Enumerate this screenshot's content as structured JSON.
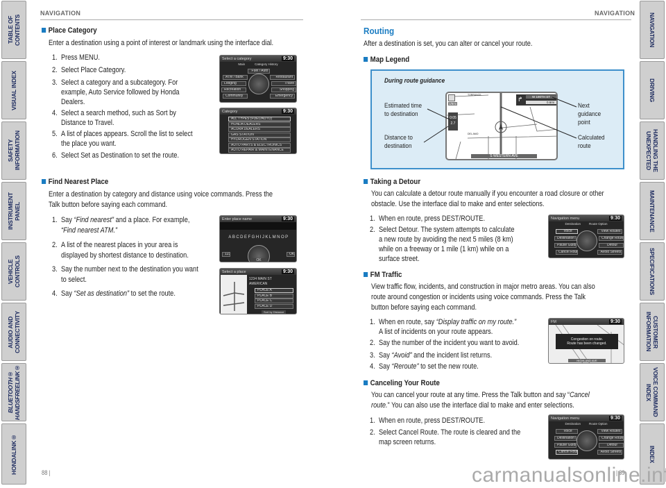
{
  "left_tabs": [
    "TABLE OF CONTENTS",
    "VISUAL INDEX",
    "SAFETY\nINFORMATION",
    "INSTRUMENT PANEL",
    "VEHICLE\nCONTROLS",
    "AUDIO AND\nCONNECTIVITY",
    "BLUETOOTH®\nHANDSFREELINK®",
    "HONDALINK®"
  ],
  "right_tabs": [
    "NAVIGATION",
    "DRIVING",
    "HANDLING THE\nUNEXPECTED",
    "MAINTENANCE",
    "SPECIFICATIONS",
    "CUSTOMER\nINFORMATION",
    "VOICE COMMAND\nINDEX",
    "INDEX"
  ],
  "left_page": {
    "header": "NAVIGATION",
    "page_number": "88 |",
    "place_category": {
      "heading": "Place Category",
      "intro": "Enter a destination using a point of interest or landmark using the interface dial.",
      "steps": [
        {
          "num": "1.",
          "lines": [
            "Press MENU."
          ]
        },
        {
          "num": "2.",
          "lines": [
            "Select Place Category."
          ]
        },
        {
          "num": "3.",
          "lines": [
            "Select a category and a subcategory. For",
            "example, Auto Service followed by Honda",
            "Dealers."
          ]
        },
        {
          "num": "4.",
          "lines": [
            "Select a search method, such as Sort by",
            "Distance to Travel."
          ]
        },
        {
          "num": "5.",
          "lines": [
            "A list of places appears. Scroll the list to select",
            "the place you want."
          ]
        },
        {
          "num": "6.",
          "lines": [
            "Select Set as Destination to set the route."
          ]
        }
      ]
    },
    "find_nearest": {
      "heading": "Find Nearest Place",
      "intro": [
        "Enter a destination by category and distance using voice commands. Press the",
        "Talk button before saying each command."
      ],
      "step1": {
        "num": "1.",
        "pre": "Say ",
        "em": "“Find nearest”",
        "post": " and a place. For example,",
        "em2": "“Find nearest ATM.”"
      },
      "step2": {
        "num": "2.",
        "lines": [
          "A list of the nearest places in your area is",
          "displayed by shortest distance to destination."
        ]
      },
      "step3": {
        "num": "3.",
        "lines": [
          "Say the number next to the destination you want",
          "to select."
        ]
      },
      "step4": {
        "num": "4.",
        "pre": "Say ",
        "em": "“Set as destination”",
        "post": " to set the route."
      }
    }
  },
  "right_page": {
    "header": "NAVIGATION",
    "page_number": "| 89",
    "routing": {
      "title": "Routing",
      "intro": "After a destination is set, you can alter or cancel your route."
    },
    "map_legend": {
      "heading": "Map Legend",
      "caption": "During route guidance",
      "labels": {
        "eta": [
          "Estimated time",
          "to destination"
        ],
        "distance": [
          "Distance to",
          "destination"
        ],
        "next": [
          "Next",
          "guidance",
          "point"
        ],
        "route": [
          "Calculated",
          "route"
        ]
      },
      "map_text": {
        "street": "W 190TH ST",
        "dist": "0.6mi",
        "bottom": "S WESTERN AVE",
        "road1": "DEL AMO",
        "road2": "TORRANCE",
        "scale": "1/8mi",
        "eta": "0:05",
        "remaining": "2.7"
      }
    },
    "detour": {
      "heading": "Taking a Detour",
      "intro": [
        "You can calculate a detour route manually if you encounter a road closure or other",
        "obstacle. Use the interface dial to make and enter selections."
      ],
      "steps": [
        {
          "num": "1.",
          "lines": [
            "When en route, press DEST/ROUTE."
          ]
        },
        {
          "num": "2.",
          "lines": [
            "Select Detour. The system attempts to calculate",
            "a new route by avoiding the next 5 miles (8 km)",
            "while on a freeway or 1 mile (1 km) while on a",
            "surface street."
          ]
        }
      ]
    },
    "fm_traffic": {
      "heading": "FM Traffic",
      "intro": [
        "View traffic flow, incidents, and construction in major metro areas. You can also",
        "route around congestion or incidents using voice commands. Press the Talk",
        "button before saying each command."
      ],
      "step1": {
        "num": "1.",
        "pre": "When en route, say ",
        "em": "“Display traffic on my route.”",
        "line2": "A list of incidents on your route appears."
      },
      "step2": {
        "num": "2.",
        "lines": [
          "Say the number of the incident you want to avoid."
        ]
      },
      "step3": {
        "num": "3.",
        "pre": "Say ",
        "em": "“Avoid”",
        "post": " and the incident list returns."
      },
      "step4": {
        "num": "4.",
        "pre": "Say ",
        "em": "“Reroute”",
        "post": " to set the new route."
      }
    },
    "cancel": {
      "heading": "Canceling Your Route",
      "intro1": {
        "pre": "You can cancel your route at any time. Press the Talk button and say “",
        "em": "Cancel"
      },
      "intro2": {
        "em": "route.",
        "post": "” You can also use the interface dial to make and enter selections."
      },
      "steps": [
        {
          "num": "1.",
          "lines": [
            "When en route, press DEST/ROUTE."
          ]
        },
        {
          "num": "2.",
          "lines": [
            "Select Cancel Route. The route is cleared and the",
            "map screen returns."
          ]
        }
      ]
    }
  },
  "screens": {
    "time": "9:30",
    "select_category": {
      "title": "Select a category",
      "tabs": [
        "Main",
        "Category History"
      ],
      "top": "Fuel / Auto",
      "left": [
        "ATM / Bank",
        "Lodging",
        "Recreation",
        "Community"
      ],
      "right": [
        "Restaurant",
        "Travel",
        "Shopping",
        "Emergency"
      ]
    },
    "category": {
      "title": "Category",
      "items": [
        "ALL TYPES (FUEL/AUTO)",
        "HONDA DEALERS",
        "ACURA DEALERS",
        "GAS STATION",
        "HYDROGEN STATION",
        "AUTO PARTS & ELECTRONICS",
        "AUTO REPAIR & MAINTENANCE"
      ]
    },
    "enter_name": {
      "title": "Enter place name",
      "letters": "ABCDEFGHIJKLMNOP",
      "num": "123",
      "ok": "OK"
    },
    "select_place": {
      "title": "Select a place",
      "address": "1234 MAIN ST",
      "type": "AMERICAN",
      "places": [
        "PLACE A",
        "PLACE B",
        "PLACE C",
        "PLACE D"
      ],
      "footer": "Sort by Distance"
    },
    "nav_menu": {
      "title": "Navigation menu",
      "tabs": [
        "Destination",
        "Route Option"
      ],
      "left": [
        "Voice",
        "Destination List",
        "Pause Guidance",
        "Cancel Route"
      ],
      "right": [
        "View Routes",
        "Change Route Preference",
        "Detour",
        "Avoid Streets"
      ]
    },
    "fm": {
      "title": "FM",
      "msg": [
        "Congestion on route.",
        "Route has been changed."
      ],
      "street": "HIGHLAND AVE"
    }
  },
  "watermark": "carmanualsonline.info",
  "colors": {
    "accent": "#1a7cc2",
    "tab_text": "#1c2a5e",
    "tab_bg": "#cfcfcf",
    "legend_bg": "#dcecf6"
  }
}
